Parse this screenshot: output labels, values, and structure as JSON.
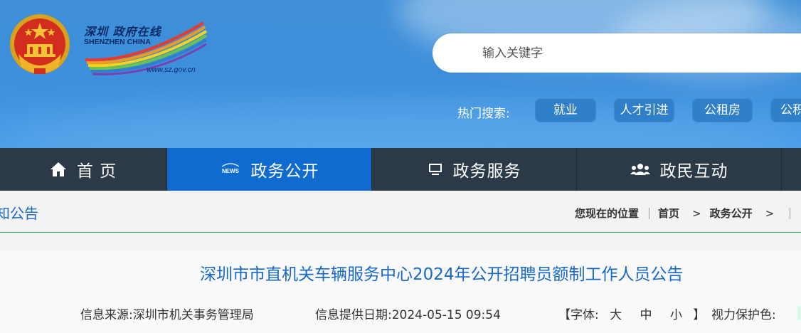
{
  "header": {
    "logo_cn": "深圳 政府在线",
    "logo_en": "SHENZHEN CHINA",
    "logo_url": "www.sz.gov.cn",
    "search_placeholder": "输入关键字",
    "hot_label": "热门搜索:",
    "hot_tags": [
      "就业",
      "人才引进",
      "公租房",
      "公积"
    ]
  },
  "nav": {
    "items": [
      {
        "label": "首 页",
        "icon": "home-icon",
        "active": false
      },
      {
        "label": "政务公开",
        "icon": "news-icon",
        "active": true
      },
      {
        "label": "政务服务",
        "icon": "monitor-icon",
        "active": false
      },
      {
        "label": "政民互动",
        "icon": "people-icon",
        "active": false
      }
    ]
  },
  "section": {
    "title": "知公告"
  },
  "breadcrumb": {
    "prefix": "您现在的位置",
    "items": [
      "首页",
      "政务公开"
    ],
    "separator": ">"
  },
  "article": {
    "title": "深圳市市直机关车辆服务中心2024年公开招聘员额制工作人员公告",
    "source": "信息来源:深圳市机关事务管理局",
    "date": "信息提供日期:2024-05-15 09:54",
    "font_open": "【字体:",
    "font_sizes": [
      "大",
      "中",
      "小"
    ],
    "font_close": "】",
    "eye_care": "视力保护色:"
  },
  "colors": {
    "header_blue": "#3e8fdc",
    "nav_bg": "#2b3a46",
    "nav_active": "#0f6bcf",
    "link_blue": "#1768c7",
    "divider_green": "#27a55b"
  }
}
